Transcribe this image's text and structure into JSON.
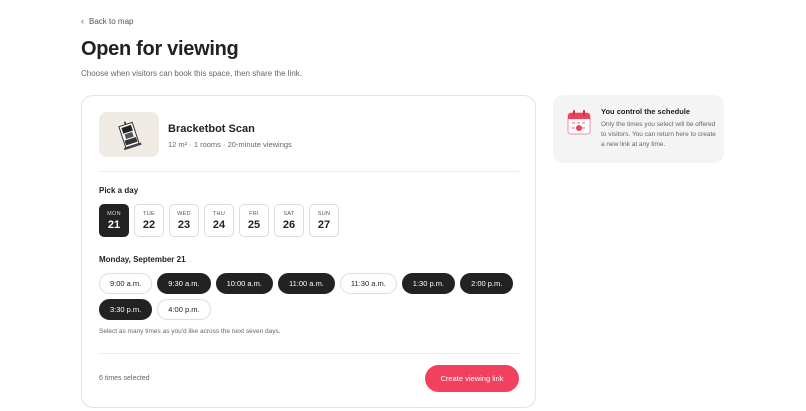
{
  "nav": {
    "back_label": "Back to map"
  },
  "header": {
    "title": "Open for viewing",
    "subtitle": "Choose when visitors can book this space, then share the link."
  },
  "space": {
    "name": "Bracketbot Scan",
    "meta": "12 m² · 1 rooms · 20-minute viewings"
  },
  "day_picker": {
    "label": "Pick a day",
    "days": [
      {
        "dow": "MON",
        "num": "21",
        "selected": true
      },
      {
        "dow": "TUE",
        "num": "22",
        "selected": false
      },
      {
        "dow": "WED",
        "num": "23",
        "selected": false
      },
      {
        "dow": "THU",
        "num": "24",
        "selected": false
      },
      {
        "dow": "FRI",
        "num": "25",
        "selected": false
      },
      {
        "dow": "SAT",
        "num": "26",
        "selected": false
      },
      {
        "dow": "SUN",
        "num": "27",
        "selected": false
      }
    ]
  },
  "time_picker": {
    "label": "Monday, September 21",
    "slots": [
      {
        "label": "9:00 a.m.",
        "selected": false
      },
      {
        "label": "9:30 a.m.",
        "selected": true
      },
      {
        "label": "10:00 a.m.",
        "selected": true
      },
      {
        "label": "11:00 a.m.",
        "selected": true
      },
      {
        "label": "11:30 a.m.",
        "selected": false
      },
      {
        "label": "1:30 p.m.",
        "selected": true
      },
      {
        "label": "2:00 p.m.",
        "selected": true
      },
      {
        "label": "3:30 p.m.",
        "selected": true
      },
      {
        "label": "4:00 p.m.",
        "selected": false
      }
    ],
    "hint": "Select as many times as you'd like across the next seven days."
  },
  "footer": {
    "count_text": "6 times selected",
    "create_label": "Create viewing link"
  },
  "info_card": {
    "icon": "calendar-icon",
    "title": "You control the schedule",
    "body": "Only the times you select will be offered to visitors. You can return here to create a new link at any time."
  },
  "colors": {
    "accent": "#f2415f",
    "selected": "#222222",
    "thumb_bg": "#efeae3",
    "panel_bg": "#f4f4f4"
  }
}
